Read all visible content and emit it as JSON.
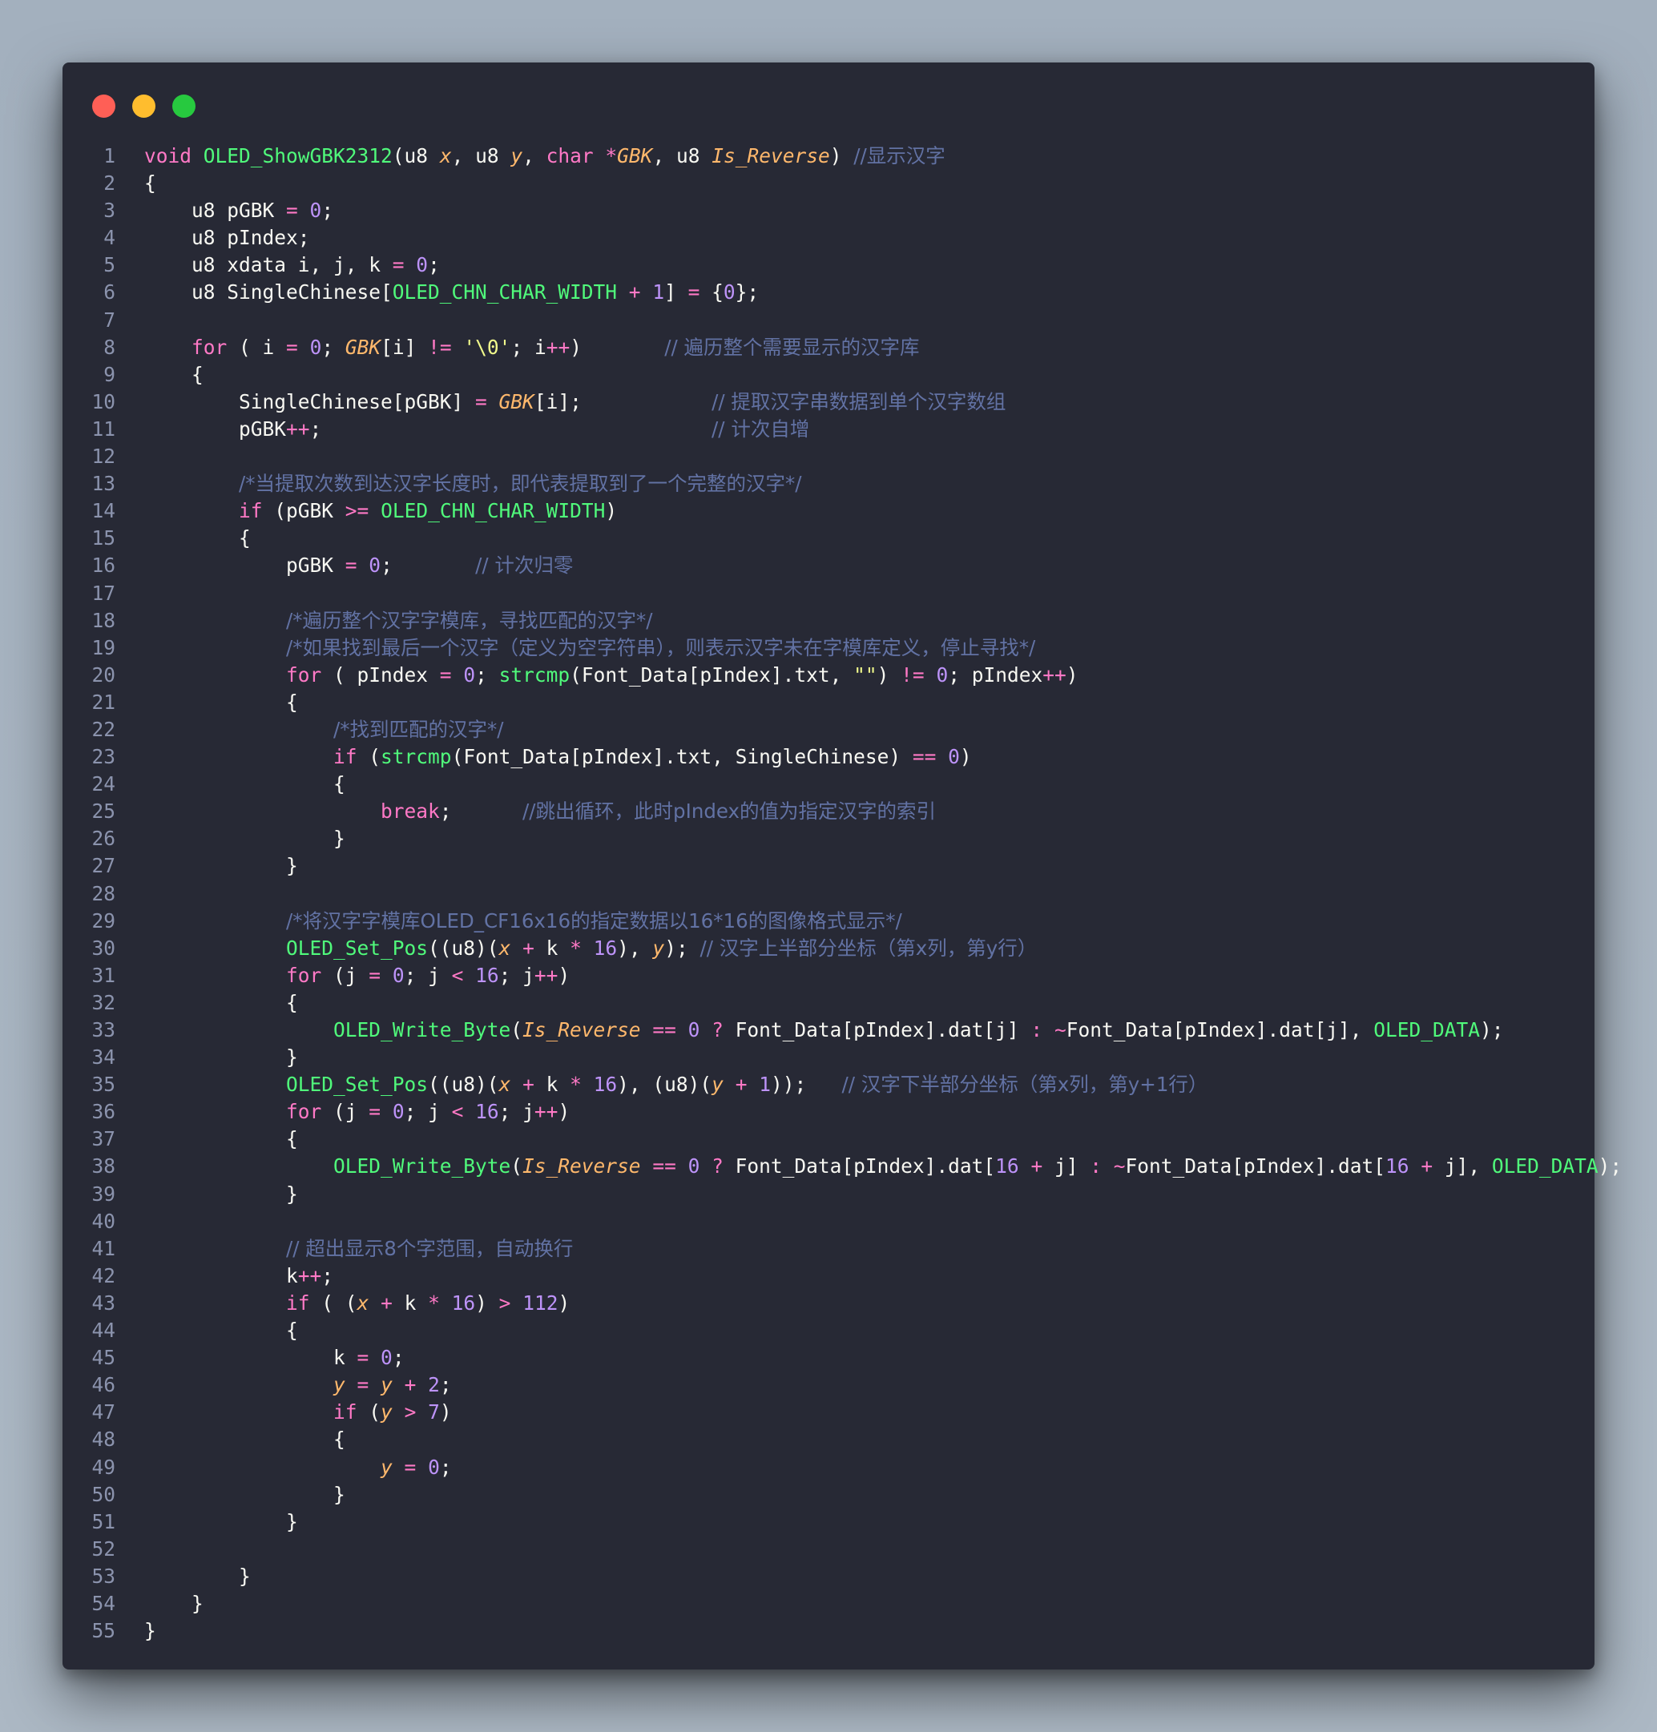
{
  "window": {
    "controls": [
      {
        "name": "close-dot",
        "color": "#ff5f56"
      },
      {
        "name": "minimize-dot",
        "color": "#ffbd2e"
      },
      {
        "name": "maximize-dot",
        "color": "#27c93f"
      }
    ]
  },
  "editor": {
    "language": "c",
    "lines": [
      "void OLED_ShowGBK2312(u8 x, u8 y, char *GBK, u8 Is_Reverse) //显示汉字",
      "{",
      "    u8 pGBK = 0;",
      "    u8 pIndex;",
      "    u8 xdata i, j, k = 0;",
      "    u8 SingleChinese[OLED_CHN_CHAR_WIDTH + 1] = {0};",
      "",
      "    for ( i = 0; GBK[i] != '\\0'; i++)       // 遍历整个需要显示的汉字库",
      "    {",
      "        SingleChinese[pGBK] = GBK[i];           // 提取汉字串数据到单个汉字数组",
      "        pGBK++;                                 // 计次自增",
      "",
      "        /*当提取次数到达汉字长度时，即代表提取到了一个完整的汉字*/",
      "        if (pGBK >= OLED_CHN_CHAR_WIDTH)",
      "        {",
      "            pGBK = 0;       // 计次归零",
      "",
      "            /*遍历整个汉字字模库，寻找匹配的汉字*/",
      "            /*如果找到最后一个汉字（定义为空字符串），则表示汉字未在字模库定义，停止寻找*/",
      "            for ( pIndex = 0; strcmp(Font_Data[pIndex].txt, \"\") != 0; pIndex++)",
      "            {",
      "                /*找到匹配的汉字*/",
      "                if (strcmp(Font_Data[pIndex].txt, SingleChinese) == 0)",
      "                {",
      "                    break;      //跳出循环，此时pIndex的值为指定汉字的索引",
      "                }",
      "            }",
      "",
      "            /*将汉字字模库OLED_CF16x16的指定数据以16*16的图像格式显示*/",
      "            OLED_Set_Pos((u8)(x + k * 16), y); // 汉字上半部分坐标（第x列，第y行）",
      "            for (j = 0; j < 16; j++)",
      "            {",
      "                OLED_Write_Byte(Is_Reverse == 0 ? Font_Data[pIndex].dat[j] : ~Font_Data[pIndex].dat[j], OLED_DATA);",
      "            }",
      "            OLED_Set_Pos((u8)(x + k * 16), (u8)(y + 1));   // 汉字下半部分坐标（第x列，第y+1行）",
      "            for (j = 0; j < 16; j++)",
      "            {",
      "                OLED_Write_Byte(Is_Reverse == 0 ? Font_Data[pIndex].dat[16 + j] : ~Font_Data[pIndex].dat[16 + j], OLED_DATA);",
      "            }",
      "",
      "            // 超出显示8个字范围，自动换行",
      "            k++;",
      "            if ( (x + k * 16) > 112)",
      "            {",
      "                k = 0;",
      "                y = y + 2;",
      "                if (y > 7)",
      "                {",
      "                    y = 0;",
      "                }",
      "            }",
      "",
      "        }",
      "    }",
      "}"
    ]
  },
  "theme": {
    "background": "#272935",
    "page_background": "#a7b3c0",
    "line_number": "#8b93ad",
    "keyword": "#ff79c6",
    "function": "#50fa7b",
    "parameter": "#ffb86c",
    "number": "#bd93f9",
    "string": "#f1fa8c",
    "comment": "#6272a4",
    "text": "#f8f8f2"
  }
}
